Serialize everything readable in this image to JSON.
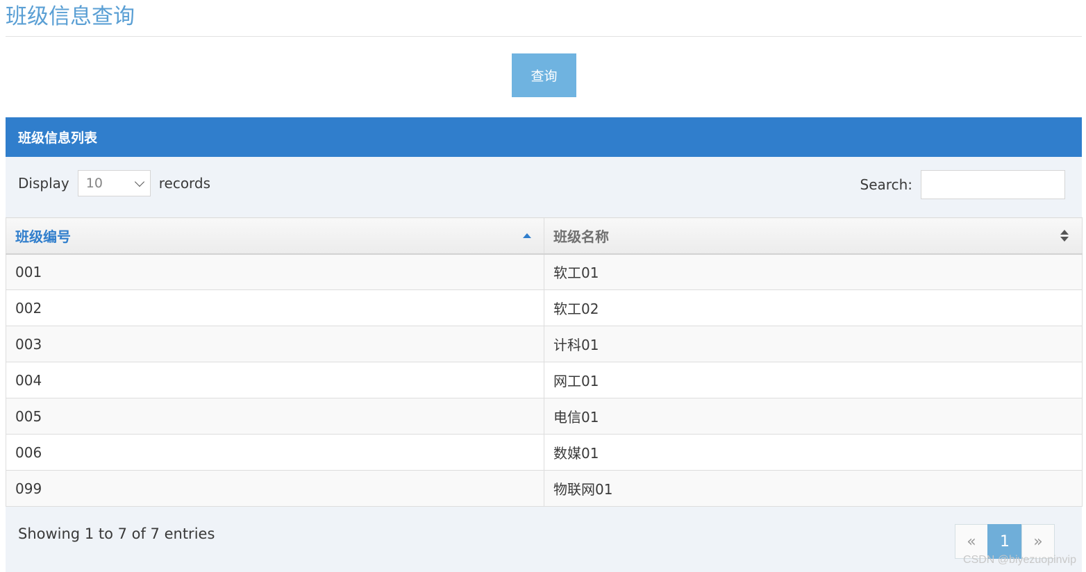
{
  "page": {
    "title": "班级信息查询",
    "query_button": "查询"
  },
  "widget": {
    "header": "班级信息列表",
    "length": {
      "prefix": "Display",
      "selected": "10",
      "suffix": "records"
    },
    "search": {
      "label": "Search:",
      "value": ""
    },
    "table": {
      "columns": [
        "班级编号",
        "班级名称"
      ],
      "rows": [
        [
          "001",
          "软工01"
        ],
        [
          "002",
          "软工02"
        ],
        [
          "003",
          "计科01"
        ],
        [
          "004",
          "网工01"
        ],
        [
          "005",
          "电信01"
        ],
        [
          "006",
          "数媒01"
        ],
        [
          "099",
          "物联网01"
        ]
      ]
    },
    "info": "Showing 1 to 7 of 7 entries",
    "pagination": {
      "prev": "«",
      "current": "1",
      "next": "»"
    }
  },
  "watermark": "CSDN @biyezuopinvip",
  "colors": {
    "header_bg": "#307ecc",
    "title": "#5a9fd4",
    "button": "#6fb3e0"
  }
}
